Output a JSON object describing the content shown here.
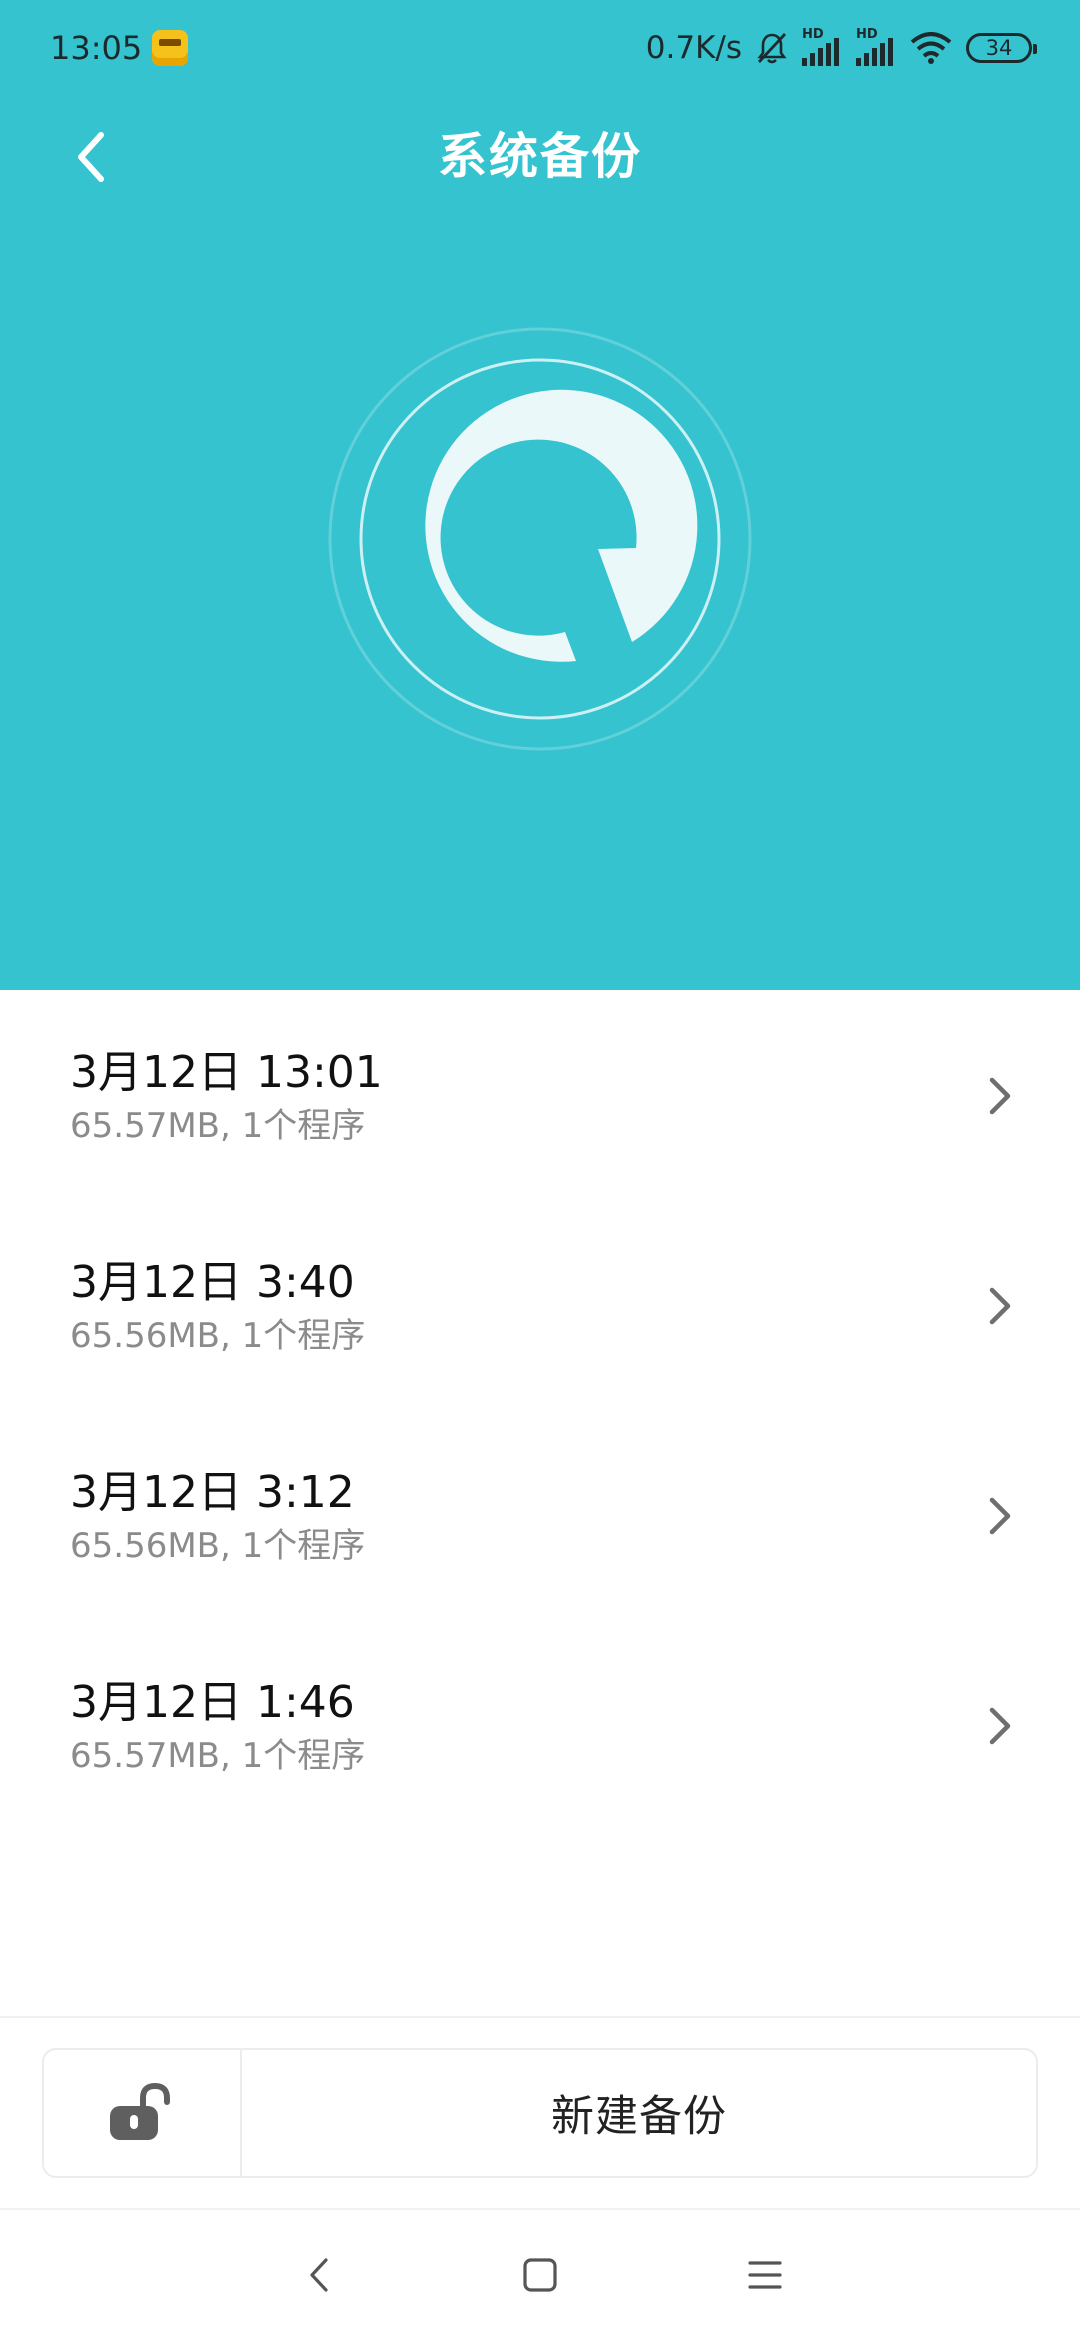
{
  "status_bar": {
    "time": "13:05",
    "net_speed": "0.7K/s",
    "signal_1_label": "HD",
    "signal_2_label": "HD",
    "battery": "34",
    "icons": [
      "app-notification-icon",
      "mute-bell-icon",
      "signal-icon",
      "signal-icon",
      "wifi-icon",
      "battery-icon"
    ]
  },
  "header": {
    "title": "系统备份",
    "back_icon": "chevron-left-icon",
    "logo_icon": "backup-logo-icon"
  },
  "backups": [
    {
      "date": "3月12日 13:01",
      "details": "65.57MB, 1个程序"
    },
    {
      "date": "3月12日 3:40",
      "details": "65.56MB, 1个程序"
    },
    {
      "date": "3月12日 3:12",
      "details": "65.56MB, 1个程序"
    },
    {
      "date": "3月12日 1:46",
      "details": "65.57MB, 1个程序"
    }
  ],
  "actions": {
    "lock_icon": "unlock-icon",
    "new_backup_label": "新建备份"
  },
  "nav_bar": {
    "icons": [
      "nav-back-icon",
      "nav-home-icon",
      "nav-menu-icon"
    ]
  },
  "colors": {
    "header_bg": "#35c3cf",
    "logo_fill": "#eaf8fa",
    "text_primary": "#111111",
    "text_secondary": "#8b8b8b"
  }
}
